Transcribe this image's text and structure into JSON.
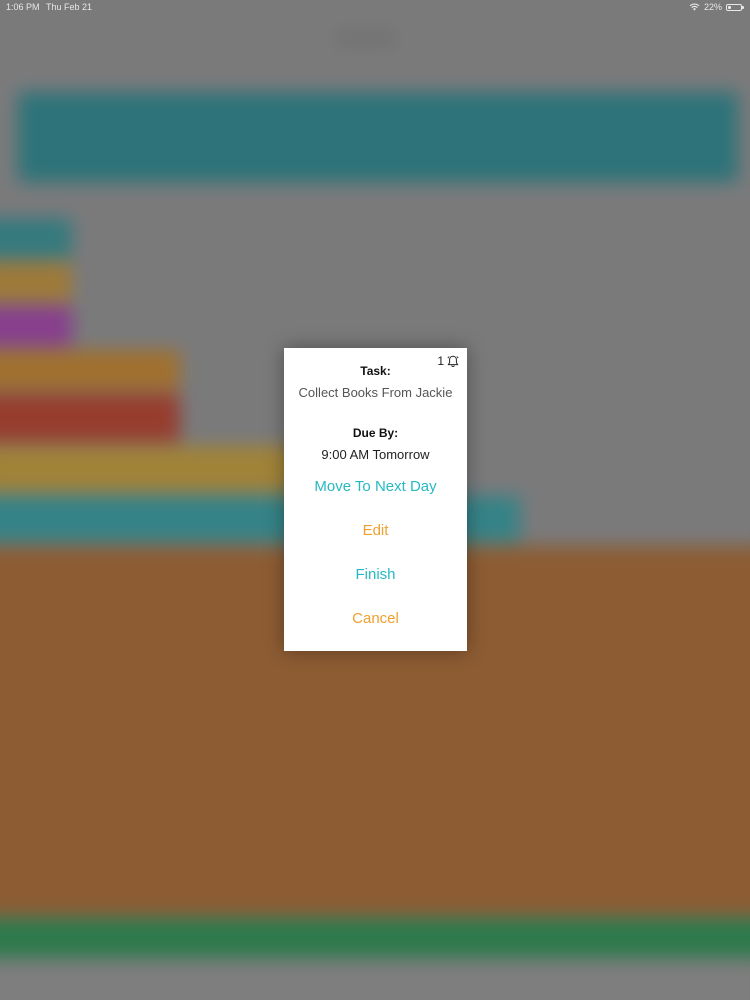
{
  "status_bar": {
    "time": "1:06 PM",
    "date": "Thu Feb 21",
    "battery": "22%",
    "battery_level": 0.22
  },
  "dialog": {
    "reminder_count": "1",
    "task_label": "Task:",
    "task_value": "Collect Books From Jackie",
    "due_label": "Due By:",
    "due_value": "9:00 AM Tomorrow",
    "actions": {
      "move_next_day": "Move To Next Day",
      "edit": "Edit",
      "finish": "Finish",
      "cancel": "Cancel"
    }
  },
  "colors": {
    "teal": "#27b9c2",
    "orange": "#f0a030",
    "dialog_bg": "#ffffff"
  },
  "icons": {
    "status_wifi": "wifi-icon",
    "status_battery": "battery-icon",
    "reminder": "bell-icon"
  }
}
